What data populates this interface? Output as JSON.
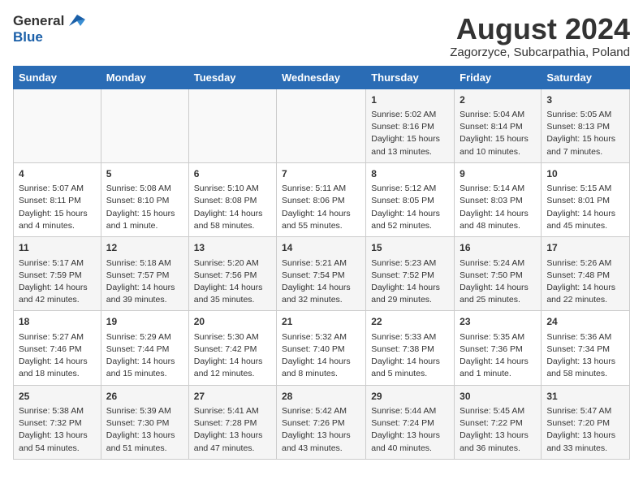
{
  "header": {
    "logo_general": "General",
    "logo_blue": "Blue",
    "title": "August 2024",
    "subtitle": "Zagorzyce, Subcarpathia, Poland"
  },
  "days_of_week": [
    "Sunday",
    "Monday",
    "Tuesday",
    "Wednesday",
    "Thursday",
    "Friday",
    "Saturday"
  ],
  "weeks": [
    [
      {
        "day": "",
        "info": ""
      },
      {
        "day": "",
        "info": ""
      },
      {
        "day": "",
        "info": ""
      },
      {
        "day": "",
        "info": ""
      },
      {
        "day": "1",
        "info": "Sunrise: 5:02 AM\nSunset: 8:16 PM\nDaylight: 15 hours\nand 13 minutes."
      },
      {
        "day": "2",
        "info": "Sunrise: 5:04 AM\nSunset: 8:14 PM\nDaylight: 15 hours\nand 10 minutes."
      },
      {
        "day": "3",
        "info": "Sunrise: 5:05 AM\nSunset: 8:13 PM\nDaylight: 15 hours\nand 7 minutes."
      }
    ],
    [
      {
        "day": "4",
        "info": "Sunrise: 5:07 AM\nSunset: 8:11 PM\nDaylight: 15 hours\nand 4 minutes."
      },
      {
        "day": "5",
        "info": "Sunrise: 5:08 AM\nSunset: 8:10 PM\nDaylight: 15 hours\nand 1 minute."
      },
      {
        "day": "6",
        "info": "Sunrise: 5:10 AM\nSunset: 8:08 PM\nDaylight: 14 hours\nand 58 minutes."
      },
      {
        "day": "7",
        "info": "Sunrise: 5:11 AM\nSunset: 8:06 PM\nDaylight: 14 hours\nand 55 minutes."
      },
      {
        "day": "8",
        "info": "Sunrise: 5:12 AM\nSunset: 8:05 PM\nDaylight: 14 hours\nand 52 minutes."
      },
      {
        "day": "9",
        "info": "Sunrise: 5:14 AM\nSunset: 8:03 PM\nDaylight: 14 hours\nand 48 minutes."
      },
      {
        "day": "10",
        "info": "Sunrise: 5:15 AM\nSunset: 8:01 PM\nDaylight: 14 hours\nand 45 minutes."
      }
    ],
    [
      {
        "day": "11",
        "info": "Sunrise: 5:17 AM\nSunset: 7:59 PM\nDaylight: 14 hours\nand 42 minutes."
      },
      {
        "day": "12",
        "info": "Sunrise: 5:18 AM\nSunset: 7:57 PM\nDaylight: 14 hours\nand 39 minutes."
      },
      {
        "day": "13",
        "info": "Sunrise: 5:20 AM\nSunset: 7:56 PM\nDaylight: 14 hours\nand 35 minutes."
      },
      {
        "day": "14",
        "info": "Sunrise: 5:21 AM\nSunset: 7:54 PM\nDaylight: 14 hours\nand 32 minutes."
      },
      {
        "day": "15",
        "info": "Sunrise: 5:23 AM\nSunset: 7:52 PM\nDaylight: 14 hours\nand 29 minutes."
      },
      {
        "day": "16",
        "info": "Sunrise: 5:24 AM\nSunset: 7:50 PM\nDaylight: 14 hours\nand 25 minutes."
      },
      {
        "day": "17",
        "info": "Sunrise: 5:26 AM\nSunset: 7:48 PM\nDaylight: 14 hours\nand 22 minutes."
      }
    ],
    [
      {
        "day": "18",
        "info": "Sunrise: 5:27 AM\nSunset: 7:46 PM\nDaylight: 14 hours\nand 18 minutes."
      },
      {
        "day": "19",
        "info": "Sunrise: 5:29 AM\nSunset: 7:44 PM\nDaylight: 14 hours\nand 15 minutes."
      },
      {
        "day": "20",
        "info": "Sunrise: 5:30 AM\nSunset: 7:42 PM\nDaylight: 14 hours\nand 12 minutes."
      },
      {
        "day": "21",
        "info": "Sunrise: 5:32 AM\nSunset: 7:40 PM\nDaylight: 14 hours\nand 8 minutes."
      },
      {
        "day": "22",
        "info": "Sunrise: 5:33 AM\nSunset: 7:38 PM\nDaylight: 14 hours\nand 5 minutes."
      },
      {
        "day": "23",
        "info": "Sunrise: 5:35 AM\nSunset: 7:36 PM\nDaylight: 14 hours\nand 1 minute."
      },
      {
        "day": "24",
        "info": "Sunrise: 5:36 AM\nSunset: 7:34 PM\nDaylight: 13 hours\nand 58 minutes."
      }
    ],
    [
      {
        "day": "25",
        "info": "Sunrise: 5:38 AM\nSunset: 7:32 PM\nDaylight: 13 hours\nand 54 minutes."
      },
      {
        "day": "26",
        "info": "Sunrise: 5:39 AM\nSunset: 7:30 PM\nDaylight: 13 hours\nand 51 minutes."
      },
      {
        "day": "27",
        "info": "Sunrise: 5:41 AM\nSunset: 7:28 PM\nDaylight: 13 hours\nand 47 minutes."
      },
      {
        "day": "28",
        "info": "Sunrise: 5:42 AM\nSunset: 7:26 PM\nDaylight: 13 hours\nand 43 minutes."
      },
      {
        "day": "29",
        "info": "Sunrise: 5:44 AM\nSunset: 7:24 PM\nDaylight: 13 hours\nand 40 minutes."
      },
      {
        "day": "30",
        "info": "Sunrise: 5:45 AM\nSunset: 7:22 PM\nDaylight: 13 hours\nand 36 minutes."
      },
      {
        "day": "31",
        "info": "Sunrise: 5:47 AM\nSunset: 7:20 PM\nDaylight: 13 hours\nand 33 minutes."
      }
    ]
  ]
}
